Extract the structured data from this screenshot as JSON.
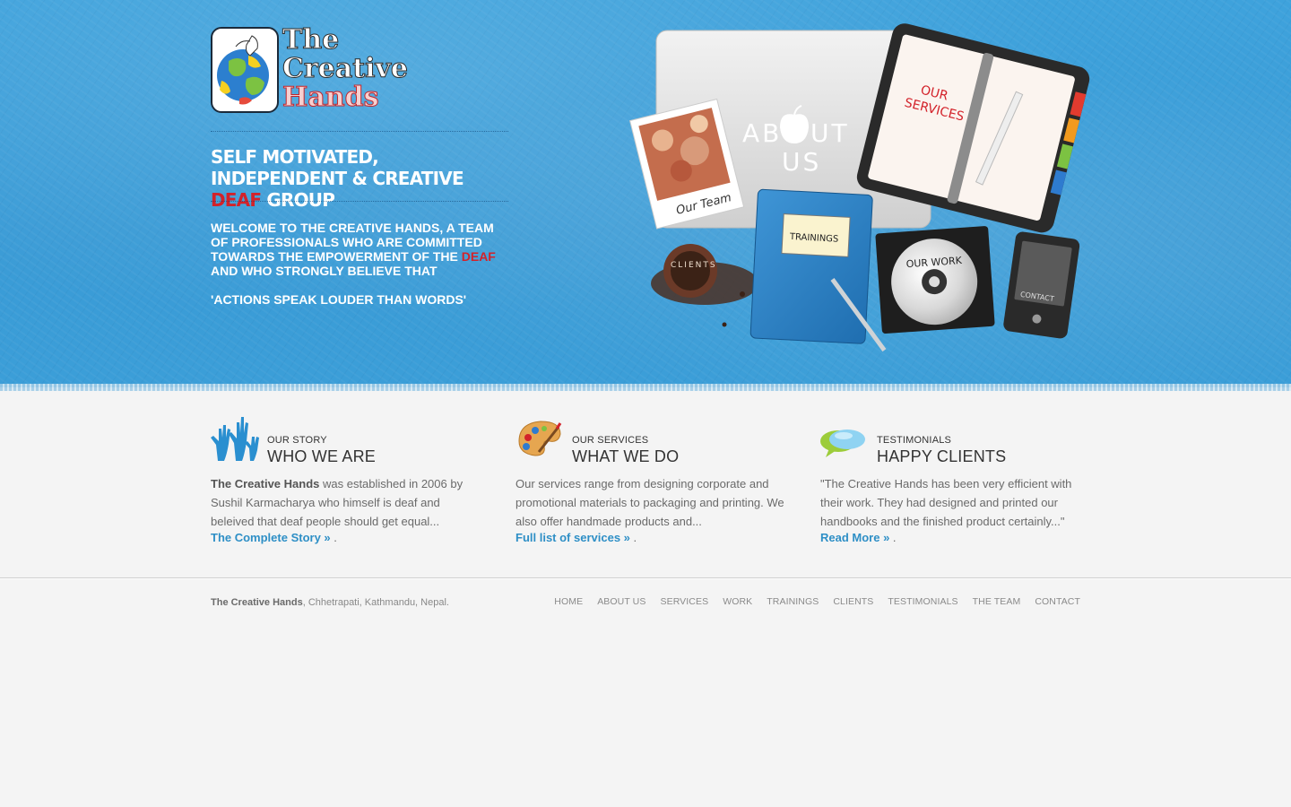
{
  "header": {
    "logo": {
      "line1": "The",
      "line2": "Creative",
      "line3": "Hands"
    },
    "tagline": {
      "part1": "Self Motivated, Independent & Creative ",
      "highlight": "Deaf",
      "part2": " Group"
    },
    "welcome": {
      "text": "Welcome to the Creative Hands, a team of professionals who are committed towards the empowerment of the ",
      "highlight": "Deaf",
      "text2": " and who strongly believe that"
    },
    "quote": "'ACTIONS SPEAK LOUDER THAN WORDS'"
  },
  "collage": {
    "about_label_1": "AB",
    "about_label_2": "UT",
    "about_label_3": "US",
    "team_label": "Our Team",
    "services_label_1": "OUR",
    "services_label_2": "SERVICES",
    "trainings_label": "TRAININGS",
    "clients_label": "CLIENTS",
    "work_label": "OUR WORK",
    "contact_label": "CONTACT"
  },
  "columns": [
    {
      "icon": "hands-icon",
      "kicker": "Our Story",
      "title": "Who We Are",
      "body_bold": "The Creative Hands",
      "body": " was established in 2006 by Sushil Karmacharya who himself is deaf and beleived that deaf people should get equal...",
      "link": "The Complete Story »",
      "after": " ."
    },
    {
      "icon": "palette-icon",
      "kicker": "Our Services",
      "title": "What We Do",
      "body_bold": "",
      "body": "Our services range from designing corporate and promotional materials to packaging and printing. We also offer handmade products and...",
      "link": "Full list of services »",
      "after": " ."
    },
    {
      "icon": "speech-bubbles-icon",
      "kicker": "Testimonials",
      "title": "Happy Clients",
      "body_bold": "",
      "body": "\"The Creative Hands has been very efficient with their work. They had designed and printed our handbooks and the finished product certainly...\"",
      "link": "Read More »",
      "after": " ."
    }
  ],
  "footer": {
    "org": "The Creative Hands",
    "address": ", Chhetrapati, Kathmandu, Nepal.",
    "nav": [
      "Home",
      "About Us",
      "Services",
      "Work",
      "Trainings",
      "Clients",
      "Testimonials",
      "The Team",
      "Contact"
    ]
  },
  "colors": {
    "blue": "#3a9bd6",
    "accent_red": "#d3222a",
    "link": "#2e8fc6"
  }
}
